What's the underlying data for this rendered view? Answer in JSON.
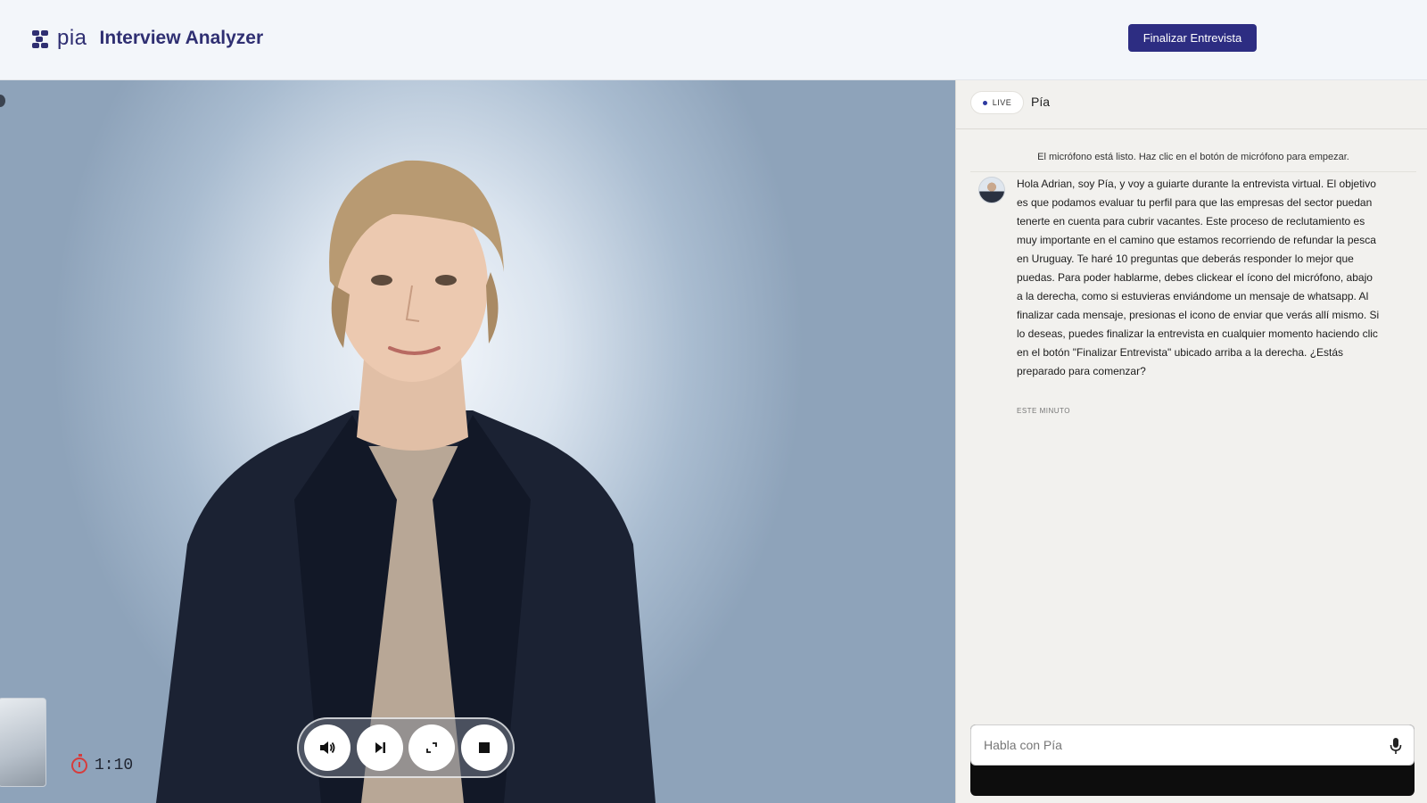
{
  "header": {
    "logo_word": "pia",
    "app_title": "Interview Analyzer",
    "finish_button": "Finalizar Entrevista"
  },
  "video": {
    "timer": "1:10",
    "controls": [
      "volume-icon",
      "skip-icon",
      "fullscreen-icon",
      "stop-icon"
    ]
  },
  "chat": {
    "live_label": "LIVE",
    "agent_name": "Pía",
    "system_message": "El micrófono está listo. Haz clic en el botón de micrófono para empezar.",
    "message": {
      "text": "Hola Adrian, soy Pía, y voy a guiarte durante la entrevista virtual. El objetivo es que podamos evaluar tu perfil para que las empresas del sector puedan tenerte en cuenta para cubrir vacantes. Este proceso de reclutamiento es muy importante en el camino que estamos recorriendo de refundar la pesca en Uruguay. Te haré 10 preguntas que deberás responder lo mejor que puedas. Para poder hablarme, debes clickear el ícono del micrófono, abajo a la derecha, como si estuvieras enviándome un mensaje de whatsapp. Al finalizar cada mensaje, presionas el icono de enviar que verás allí mismo. Si lo deseas, puedes finalizar la entrevista en cualquier momento haciendo clic en el botón \"Finalizar Entrevista\" ubicado arriba a la derecha. ¿Estás preparado para comenzar?",
      "time": "ESTE MINUTO"
    },
    "input_placeholder": "Habla con Pía"
  },
  "colors": {
    "brand": "#2f2f72",
    "button": "#2d2d82",
    "timer_icon": "#d63c3c"
  }
}
